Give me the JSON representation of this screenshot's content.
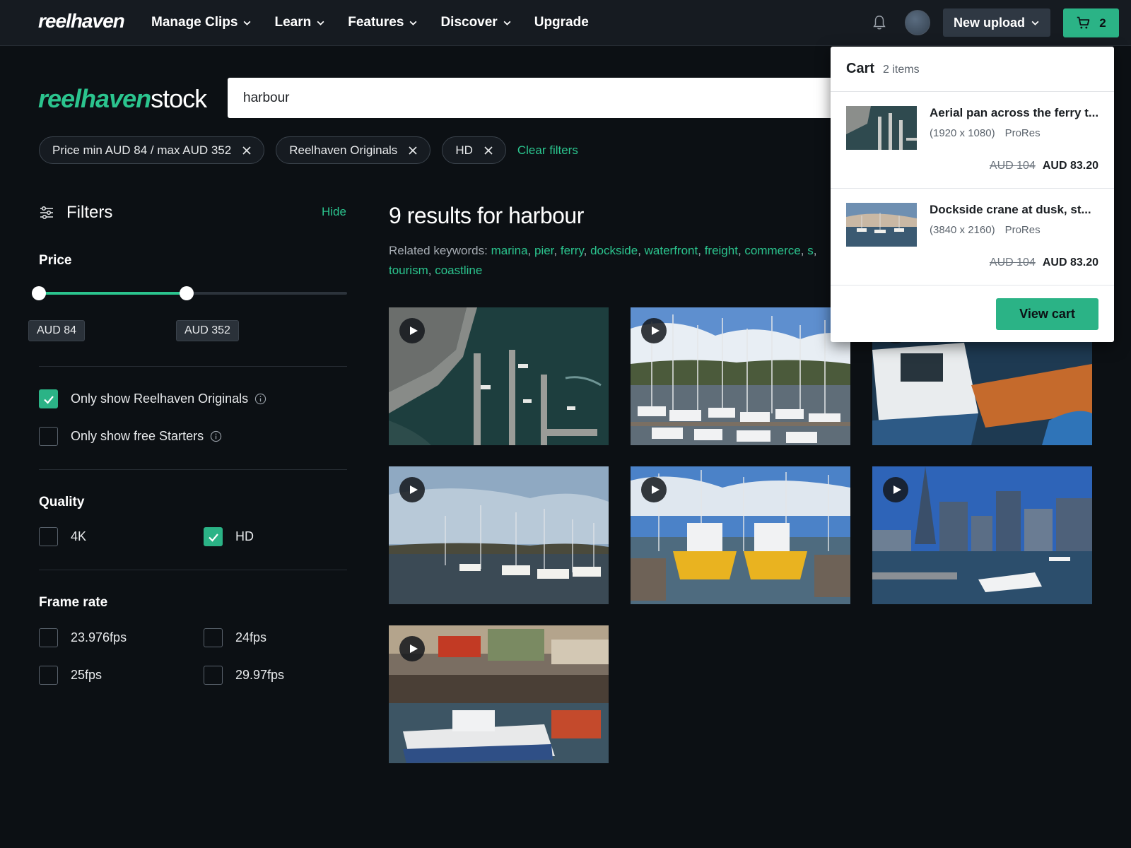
{
  "nav": {
    "logo": "reelhaven",
    "links": [
      {
        "label": "Manage Clips",
        "dropdown": true
      },
      {
        "label": "Learn",
        "dropdown": true
      },
      {
        "label": "Features",
        "dropdown": true
      },
      {
        "label": "Discover",
        "dropdown": true
      },
      {
        "label": "Upgrade",
        "dropdown": false
      }
    ],
    "upload_label": "New upload",
    "cart_count": "2"
  },
  "brand": {
    "logo_main": "reelhaven",
    "logo_suffix": "stock"
  },
  "search": {
    "value": "harbour"
  },
  "chips": [
    {
      "label": "Price min AUD 84 / max AUD 352"
    },
    {
      "label": "Reelhaven Originals"
    },
    {
      "label": "HD"
    }
  ],
  "clear_filters": "Clear filters",
  "filters": {
    "title": "Filters",
    "hide": "Hide",
    "price": {
      "title": "Price",
      "min_label": "AUD 84",
      "max_label": "AUD 352",
      "min_pos": 0.0,
      "max_pos": 0.48
    },
    "options": [
      {
        "label": "Only show Reelhaven Originals",
        "checked": true
      },
      {
        "label": "Only show free Starters",
        "checked": false
      }
    ],
    "quality": {
      "title": "Quality",
      "options": [
        {
          "label": "4K",
          "checked": false
        },
        {
          "label": "HD",
          "checked": true
        }
      ]
    },
    "frame_rate": {
      "title": "Frame rate",
      "options": [
        {
          "label": "23.976fps",
          "checked": false
        },
        {
          "label": "24fps",
          "checked": false
        },
        {
          "label": "25fps",
          "checked": false
        },
        {
          "label": "29.97fps",
          "checked": false
        }
      ]
    }
  },
  "results": {
    "title": "9 results for harbour",
    "related_prefix": "Related keywords: ",
    "keywords": [
      "marina",
      "pier",
      "ferry",
      "dockside",
      "waterfront",
      "freight",
      "commerce",
      "s",
      "tourism",
      "coastline"
    ]
  },
  "cart": {
    "title": "Cart",
    "count_label": "2 items",
    "items": [
      {
        "title": "Aerial pan across the ferry t...",
        "resolution": "(1920 x 1080)",
        "format": "ProRes",
        "old_price": "AUD 104",
        "price": "AUD 83.20"
      },
      {
        "title": "Dockside crane at dusk, st...",
        "resolution": "(3840 x 2160)",
        "format": "ProRes",
        "old_price": "AUD 104",
        "price": "AUD 83.20"
      }
    ],
    "view_cart": "View cart"
  },
  "colors": {
    "accent": "#2bb386",
    "link": "#2bc48e",
    "background": "#0c1014"
  }
}
